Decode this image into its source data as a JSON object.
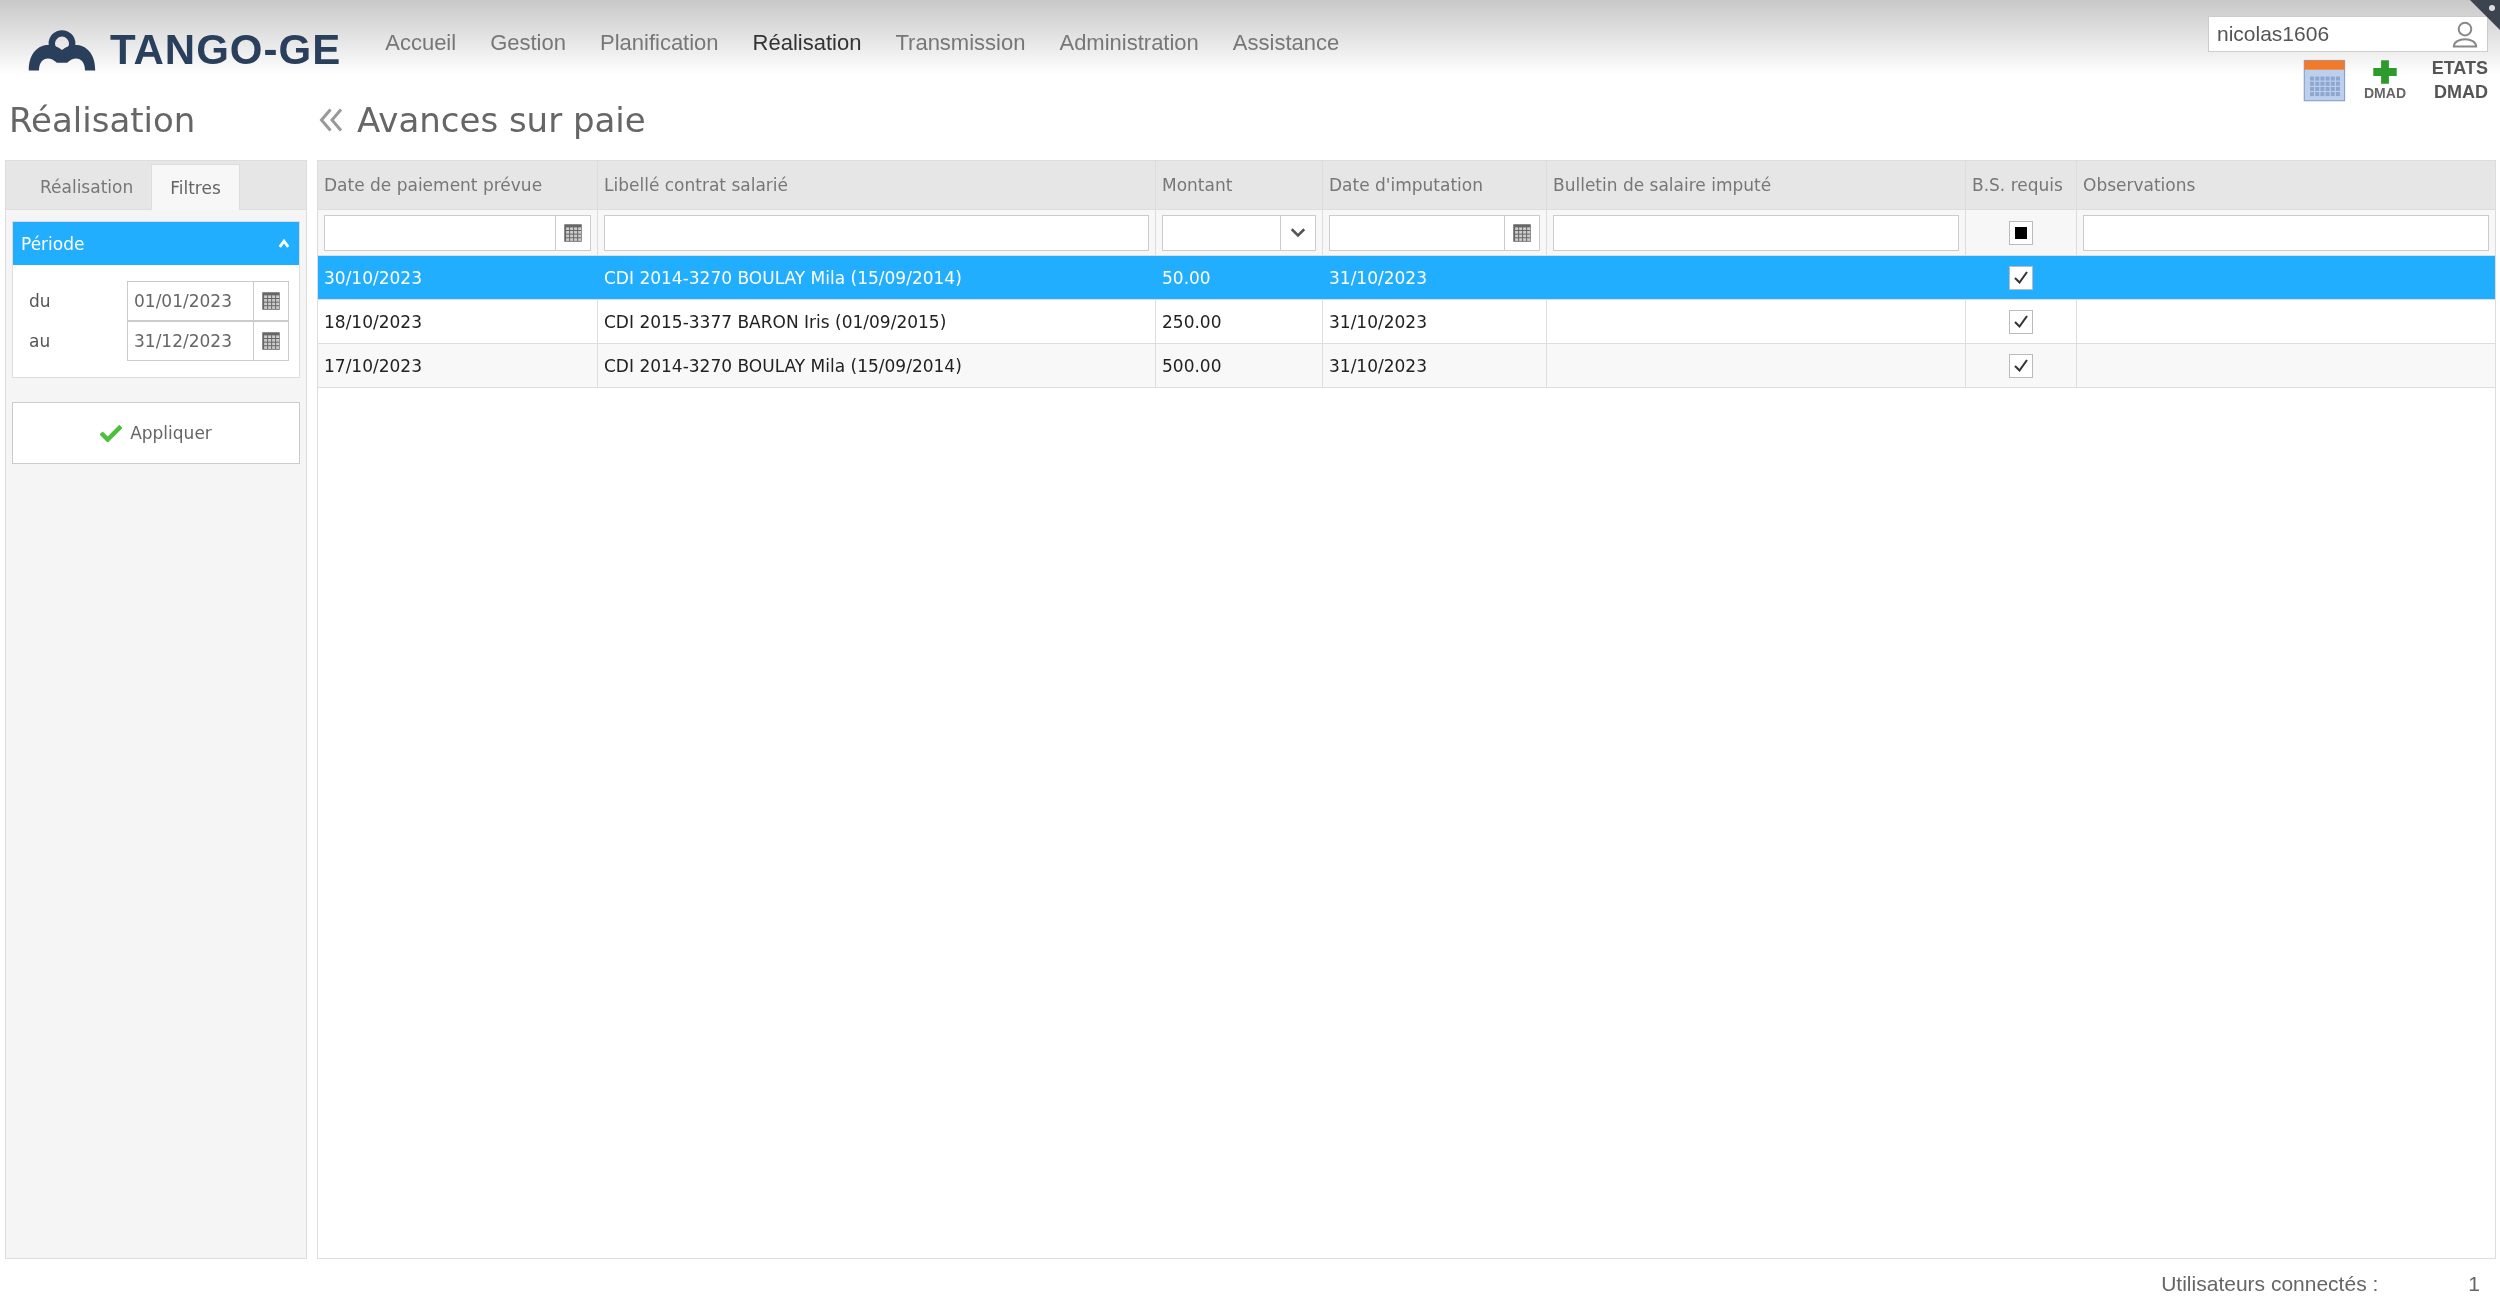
{
  "logo": {
    "text": "TANGO-GE"
  },
  "nav": [
    {
      "label": "Accueil",
      "selected": false
    },
    {
      "label": "Gestion",
      "selected": false
    },
    {
      "label": "Planification",
      "selected": false
    },
    {
      "label": "Réalisation",
      "selected": true
    },
    {
      "label": "Transmission",
      "selected": false
    },
    {
      "label": "Administration",
      "selected": false
    },
    {
      "label": "Assistance",
      "selected": false
    }
  ],
  "user": {
    "value": "nicolas1606"
  },
  "tools": [
    {
      "kind": "calendar"
    },
    {
      "kind": "add",
      "label": "DMAD"
    },
    {
      "kind": "text",
      "label": "ETATS DMAD"
    }
  ],
  "sidebar": {
    "title": "Réalisation",
    "tabs": [
      {
        "label": "Réalisation",
        "selected": false
      },
      {
        "label": "Filtres",
        "selected": true
      }
    ],
    "period": {
      "title": "Période",
      "expanded": true,
      "fields": [
        {
          "label": "du",
          "value": "01/01/2023"
        },
        {
          "label": "au",
          "value": "31/12/2023"
        }
      ]
    },
    "apply_button": "Appliquer"
  },
  "page_title": "Avances sur paie",
  "table": {
    "columns": [
      "Date de paiement prévue",
      "Libellé contrat salarié",
      "Montant",
      "Date d'imputation",
      "Bulletin de salaire imputé",
      "B.S. requis",
      "Observations"
    ],
    "filters": [
      {
        "kind": "date"
      },
      {
        "kind": "text"
      },
      {
        "kind": "select"
      },
      {
        "kind": "date"
      },
      {
        "kind": "text"
      },
      {
        "kind": "tristate",
        "indeterminate": true
      },
      {
        "kind": "text"
      }
    ],
    "rows": [
      {
        "selected": true,
        "date": "30/10/2023",
        "contract": "CDI 2014-3270 BOULAY Mila (15/09/2014)",
        "amount": "50.00",
        "imputation": "31/10/2023",
        "bs_required": true
      },
      {
        "selected": false,
        "date": "18/10/2023",
        "contract": "CDI 2015-3377 BARON Iris (01/09/2015)",
        "amount": "250.00",
        "imputation": "31/10/2023",
        "bs_required": true
      },
      {
        "selected": false,
        "date": "17/10/2023",
        "contract": "CDI 2014-3270 BOULAY Mila (15/09/2014)",
        "amount": "500.00",
        "imputation": "31/10/2023",
        "bs_required": true
      }
    ]
  },
  "status_bar": {
    "label": "Utilisateurs connectés :",
    "value": "1"
  }
}
